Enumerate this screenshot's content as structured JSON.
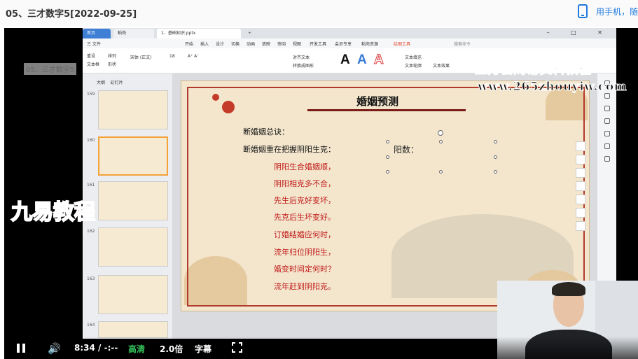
{
  "page": {
    "title": "05、三才数字5[2022-09-25]",
    "mobile_link": "用手机，随"
  },
  "ppt": {
    "tabs": [
      {
        "label": "首页"
      },
      {
        "label": "稻壳"
      },
      {
        "label": "1、基础知识.pptx"
      }
    ],
    "menu": [
      "三 文件",
      "开始",
      "插入",
      "设计",
      "切换",
      "动画",
      "放映",
      "审阅",
      "视图",
      "开发工具",
      "会员专享",
      "稻壳资源",
      "绘图工具",
      "搜索命令"
    ],
    "ribbon": [
      "文本框",
      "形状",
      "排列",
      "重设",
      "宋体 (正文)",
      "18",
      "A⁺ A⁻",
      "转换成图形",
      "对齐文本",
      "文本填充",
      "文本轮廓",
      "文本效果"
    ],
    "sidebar_tabs": [
      "大纲",
      "幻灯片"
    ],
    "slide_numbers": [
      "159",
      "160",
      "161",
      "162",
      "163",
      "164"
    ]
  },
  "slide": {
    "title": "婚姻预测",
    "heading1": "断婚姻总诀：",
    "heading2": "断婚姻重在把握阴阳生克：",
    "side_text": "阳数：",
    "lines": [
      "阴阳生合婚姻顺，",
      "阴阳相克多不合，",
      "先生后克好变坏，",
      "先克后生坏变好。",
      "订婚结婚应何时，",
      "流年归位阴阳生，",
      "婚变时间定何时？",
      "流年赶到阴阳克。"
    ]
  },
  "watermarks": {
    "line1": "上万套周易资料教程",
    "line2": "www.265zhouyiw.com",
    "small": "05、三才数字5",
    "logo": "九易教程"
  },
  "controls": {
    "time": "8:34 / -:--",
    "quality": "高清",
    "speed": "2.0倍",
    "subtitles": "字幕"
  },
  "colors": {
    "accent_red": "#c21b1b",
    "quality_green": "#35c25a",
    "link_blue": "#1f7ae0"
  }
}
